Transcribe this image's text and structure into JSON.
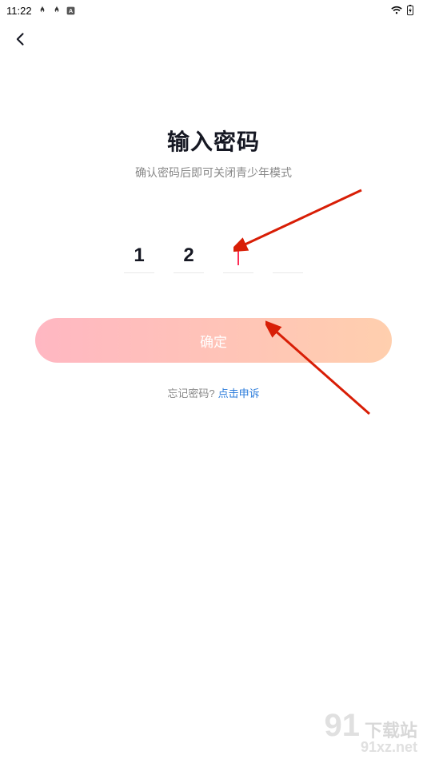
{
  "status": {
    "time": "11:22"
  },
  "page": {
    "title": "输入密码",
    "subtitle": "确认密码后即可关闭青少年模式",
    "pin": [
      "1",
      "2",
      "",
      ""
    ],
    "confirm_label": "确定",
    "forgot_label": "忘记密码?",
    "appeal_link": "点击申诉"
  },
  "watermark": {
    "num": "91",
    "text": "下载站",
    "url": "91xz.net"
  }
}
